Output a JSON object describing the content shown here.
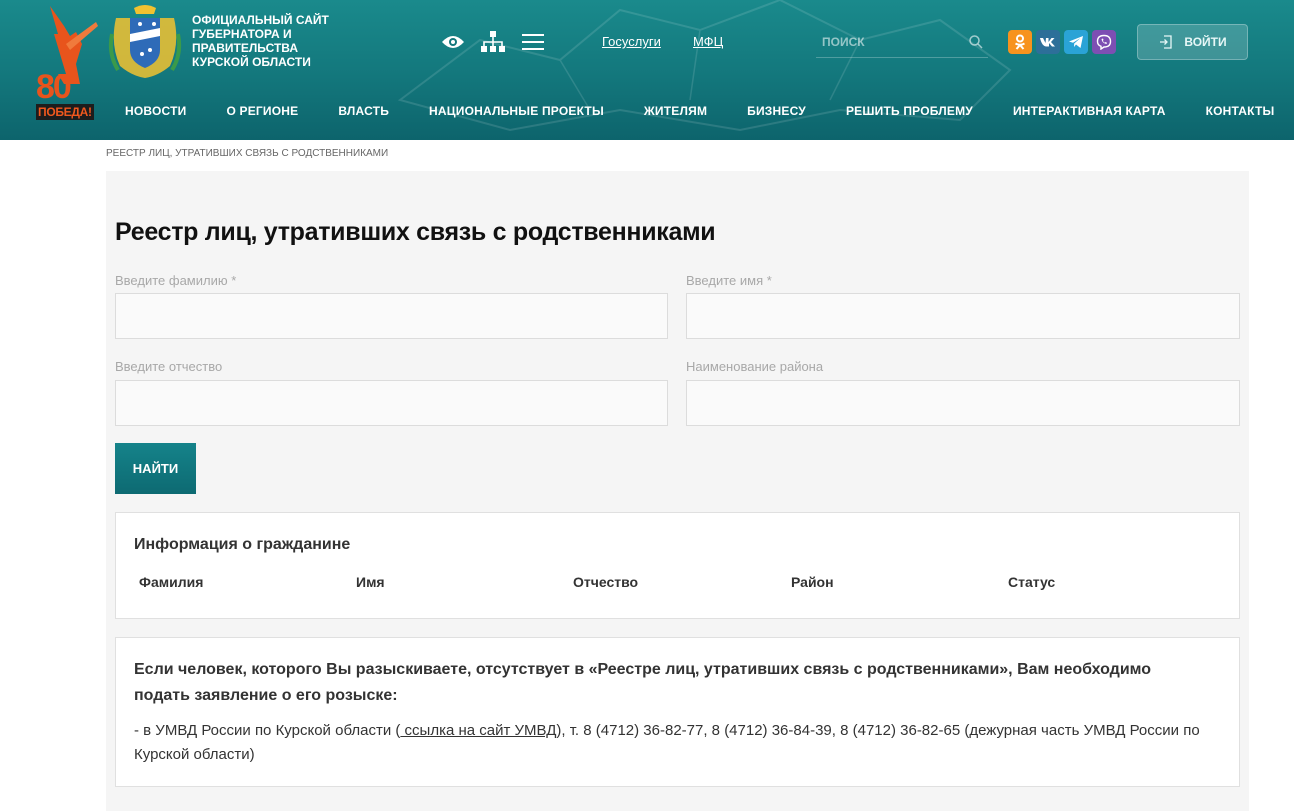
{
  "header": {
    "badge": {
      "number": "80",
      "word": "ПОБЕДА!"
    },
    "site_title": [
      "ОФИЦИАЛЬНЫЙ САЙТ",
      "ГУБЕРНАТОРА И",
      "ПРАВИТЕЛЬСТВА",
      "КУРСКОЙ ОБЛАСТИ"
    ],
    "top_icons": [
      "eye-icon",
      "sitemap-icon",
      "menu-icon"
    ],
    "links": {
      "gosuslugi": "Госуслуги",
      "mfc": "МФЦ"
    },
    "search": {
      "placeholder": "ПОИСК",
      "icon": "search-icon"
    },
    "socials": [
      {
        "name": "odnoklassniki",
        "glyph": "ok",
        "color": "#f7931e"
      },
      {
        "name": "vkontakte",
        "glyph": "vk",
        "color": "#2d6f99"
      },
      {
        "name": "telegram",
        "glyph": "tg",
        "color": "#2aa3d6"
      },
      {
        "name": "viber",
        "glyph": "vb",
        "color": "#7d4fb3"
      }
    ],
    "login_label": "ВОЙТИ",
    "nav": [
      "НОВОСТИ",
      "О РЕГИОНЕ",
      "ВЛАСТЬ",
      "НАЦИОНАЛЬНЫЕ ПРОЕКТЫ",
      "ЖИТЕЛЯМ",
      "БИЗНЕСУ",
      "РЕШИТЬ ПРОБЛЕМУ",
      "ИНТЕРАКТИВНАЯ КАРТА",
      "КОНТАКТЫ"
    ]
  },
  "breadcrumb": "РЕЕСТР ЛИЦ, УТРАТИВШИХ СВЯЗЬ С РОДСТВЕННИКАМИ",
  "page_title": "Реестр лиц, утративших связь с родственниками",
  "form": {
    "surname_label": "Введите фамилию *",
    "surname_value": "",
    "name_label": "Введите имя *",
    "name_value": "",
    "patronymic_label": "Введите отчество",
    "patronymic_value": "",
    "district_label": "Наименование района",
    "district_value": "",
    "submit_label": "НАЙТИ"
  },
  "info": {
    "title": "Информация о гражданине",
    "columns": [
      "Фамилия",
      "Имя",
      "Отчество",
      "Район",
      "Статус"
    ]
  },
  "note": {
    "lead": "Если человек, которого Вы разыскиваете, отсутствует в «Реестре лиц, утративших связь с родственниками», Вам необходимо подать заявление о его розыске:",
    "line_prefix": "- в УМВД России по Курской области (",
    "link_text": " ссылка на сайт УМВД",
    "line_suffix": "), т. 8 (4712) 36-82-77, 8 (4712) 36-84-39, 8 (4712) 36-82-65 (дежурная часть УМВД России по Курской области)"
  },
  "colors": {
    "header_teal": "#13777c",
    "button_teal": "#0d6a72",
    "badge_orange": "#e8541c"
  }
}
